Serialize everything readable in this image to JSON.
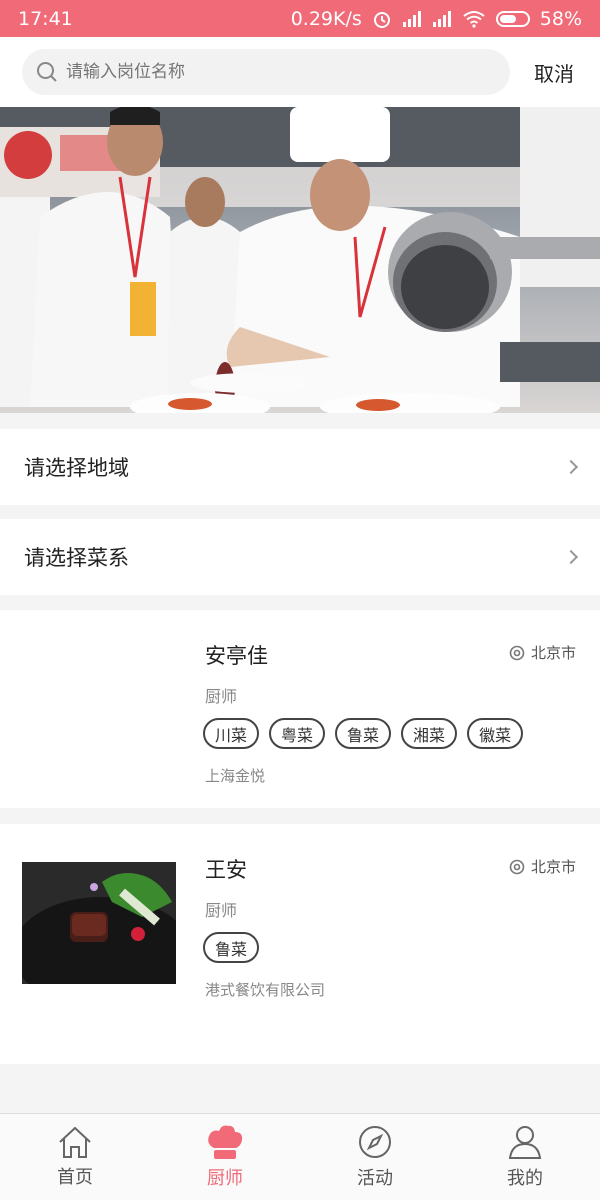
{
  "status_bar": {
    "time": "17:41",
    "speed": "0.29K/s",
    "battery": "58%"
  },
  "search": {
    "placeholder": "请输入岗位名称",
    "cancel_label": "取消"
  },
  "filters": {
    "region_label": "请选择地域",
    "cuisine_label": "请选择菜系"
  },
  "chefs": [
    {
      "name": "安亭佳",
      "location": "北京市",
      "role": "厨师",
      "tags": [
        "川菜",
        "粤菜",
        "鲁菜",
        "湘菜",
        "徽菜"
      ],
      "company": "上海金悦"
    },
    {
      "name": "王安",
      "location": "北京市",
      "role": "厨师",
      "tags": [
        "鲁菜"
      ],
      "company": "港式餐饮有限公司"
    }
  ],
  "tabs": [
    {
      "label": "首页",
      "icon": "home-icon"
    },
    {
      "label": "厨师",
      "icon": "chef-hat-icon"
    },
    {
      "label": "活动",
      "icon": "compass-icon"
    },
    {
      "label": "我的",
      "icon": "user-icon"
    }
  ],
  "colors": {
    "accent": "#f06a78"
  }
}
